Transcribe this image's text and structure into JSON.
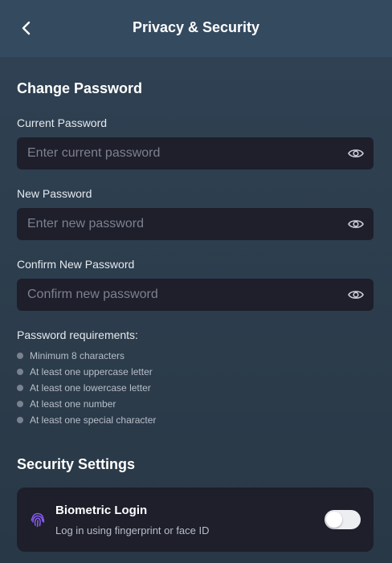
{
  "header": {
    "title": "Privacy & Security"
  },
  "change_password": {
    "section_title": "Change Password",
    "fields": [
      {
        "label": "Current Password",
        "placeholder": "Enter current password",
        "value": ""
      },
      {
        "label": "New Password",
        "placeholder": "Enter new password",
        "value": ""
      },
      {
        "label": "Confirm New Password",
        "placeholder": "Confirm new password",
        "value": ""
      }
    ],
    "requirements_title": "Password requirements:",
    "requirements": [
      "Minimum 8 characters",
      "At least one uppercase letter",
      "At least one lowercase letter",
      "At least one number",
      "At least one special character"
    ]
  },
  "security_settings": {
    "section_title": "Security Settings",
    "biometric": {
      "title": "Biometric Login",
      "subtitle": "Log in using fingerprint or face ID",
      "enabled": false,
      "icon": "fingerprint-icon"
    }
  },
  "icons": {
    "back": "chevron-left-icon",
    "reveal": "eye-icon"
  },
  "colors": {
    "header_bg": "#344a5f",
    "page_bg": "#2c3c4d",
    "field_bg": "#1e1f2b",
    "accent": "#8b5cf6"
  }
}
